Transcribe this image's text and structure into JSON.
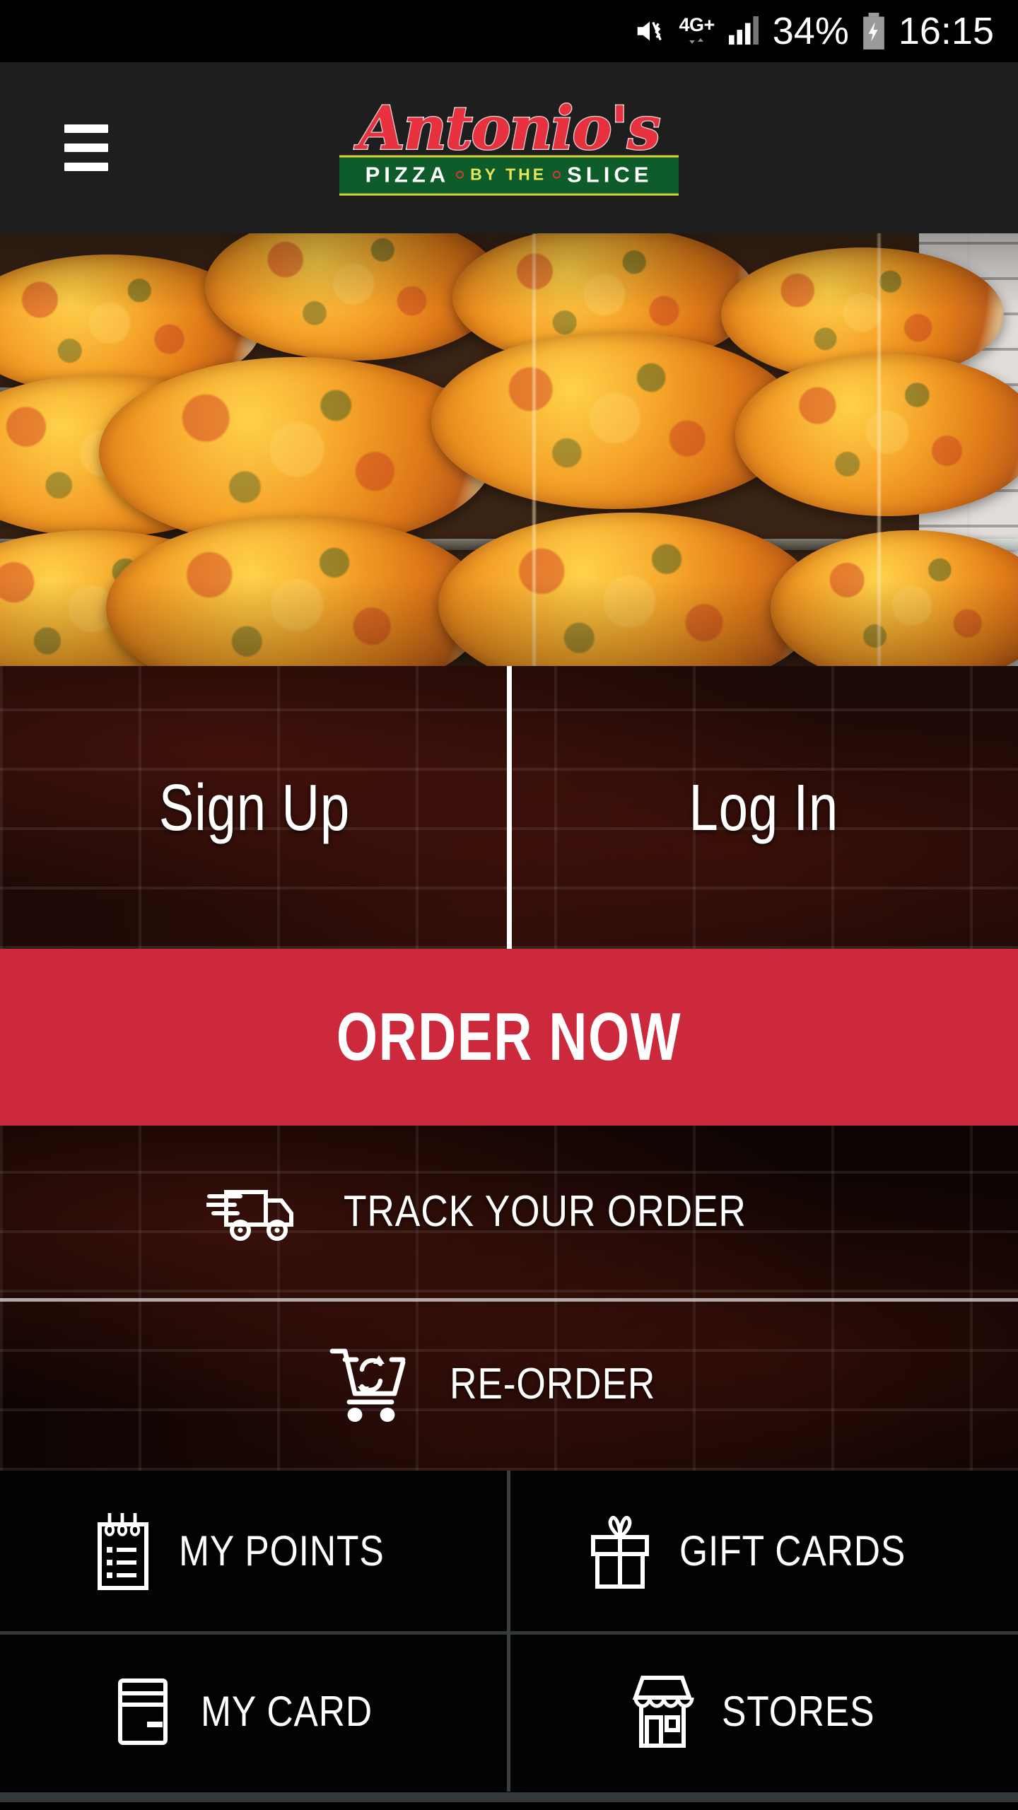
{
  "status_bar": {
    "mute_icon": "mute-vibrate-icon",
    "network_label": "4G+",
    "data_arrows_icon": "data-transfer-arrows-icon",
    "signal_icon": "signal-bars-icon",
    "battery_percent": "34%",
    "battery_icon": "battery-charging-icon",
    "time": "16:15"
  },
  "header": {
    "menu_icon": "hamburger-menu-icon",
    "logo": {
      "script_text": "Antonio's",
      "banner_left": "PIZZA",
      "banner_mid": "BY THE",
      "banner_right": "SLICE",
      "script_color": "#e8313f",
      "banner_bg": "#0d5c2a",
      "banner_rule": "#d8cf3c"
    },
    "background": "#1e1e1e"
  },
  "hero": {
    "alt": "pizza-display-case-photo"
  },
  "auth": {
    "sign_up": "Sign Up",
    "log_in": "Log In"
  },
  "order_now": {
    "label": "ORDER NOW",
    "color": "#cc2a3c"
  },
  "actions": [
    {
      "label": "TRACK YOUR ORDER",
      "icon": "delivery-truck-icon",
      "name": "track-your-order"
    },
    {
      "label": "RE-ORDER",
      "icon": "reorder-cart-icon",
      "name": "re-order"
    }
  ],
  "grid": [
    {
      "label": "MY POINTS",
      "icon": "notepad-points-icon",
      "name": "my-points"
    },
    {
      "label": "GIFT CARDS",
      "icon": "gift-box-icon",
      "name": "gift-cards"
    },
    {
      "label": "MY CARD",
      "icon": "credit-card-icon",
      "name": "my-card"
    },
    {
      "label": "STORES",
      "icon": "storefront-icon",
      "name": "stores"
    }
  ]
}
